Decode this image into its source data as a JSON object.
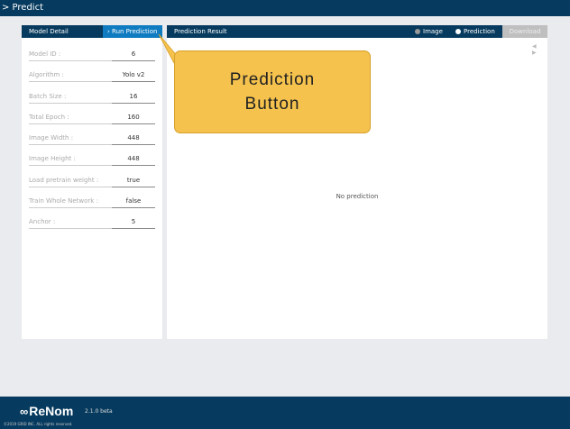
{
  "header": {
    "title": "> Predict"
  },
  "left_panel": {
    "title": "Model Detail",
    "run_button": "› Run Prediction",
    "params": [
      {
        "label": "Model ID :",
        "value": "6"
      },
      {
        "label": "Algorithm :",
        "value": "Yolo v2"
      },
      {
        "label": "Batch Size :",
        "value": "16"
      },
      {
        "label": "Total Epoch :",
        "value": "160"
      },
      {
        "label": "Image Width :",
        "value": "448"
      },
      {
        "label": "Image Height :",
        "value": "448"
      },
      {
        "label": "Load pretrain weight :",
        "value": "true"
      },
      {
        "label": "Train Whole Network :",
        "value": "false"
      },
      {
        "label": "Anchor :",
        "value": "5"
      }
    ]
  },
  "right_panel": {
    "title": "Prediction Result",
    "toggle_image": "Image",
    "toggle_prediction": "Prediction",
    "download": "Download",
    "pager": "◀ ▶",
    "empty_message": "No prediction"
  },
  "callout": {
    "line1": "Prediction",
    "line2": "Button",
    "color": "#f4c24d"
  },
  "footer": {
    "logo": "ReNom",
    "logo_symbol": "∞",
    "version": "2.1.0 beta",
    "copyright": "©2019 GRID INC. ALL rights reserved."
  },
  "colors": {
    "navy": "#063a5e",
    "accent": "#0f7bc0",
    "background": "#e9ebee"
  }
}
